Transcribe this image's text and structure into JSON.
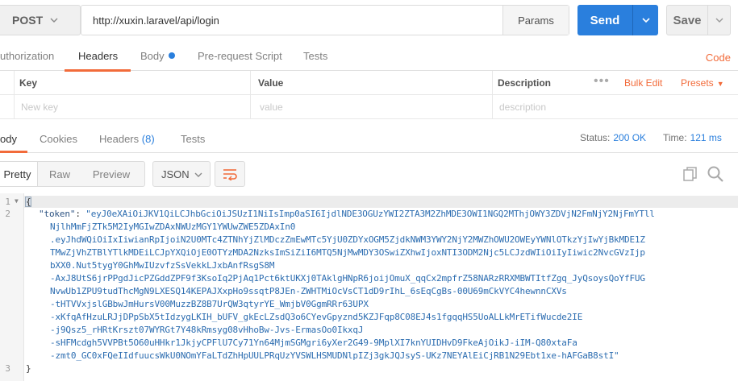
{
  "request": {
    "method": "POST",
    "url": "http://xuxin.laravel/api/login",
    "params_label": "Params",
    "send_label": "Send",
    "save_label": "Save"
  },
  "request_tabs": [
    {
      "label": "uthorization"
    },
    {
      "label": "Headers"
    },
    {
      "label": "Body"
    },
    {
      "label": "Pre-request Script"
    },
    {
      "label": "Tests"
    }
  ],
  "code_label": "Code",
  "headers_table": {
    "columns": [
      "Key",
      "Value",
      "Description"
    ],
    "bulk_edit": "Bulk Edit",
    "presets": "Presets",
    "placeholders": [
      "New key",
      "value",
      "description"
    ]
  },
  "response_tabs": [
    {
      "label": "ody"
    },
    {
      "label": "Cookies"
    },
    {
      "label": "Headers",
      "count": "(8)"
    },
    {
      "label": "Tests"
    }
  ],
  "response_status": {
    "status_label": "Status:",
    "status_value": "200 OK",
    "time_label": "Time:",
    "time_value": "121 ms"
  },
  "response_toolbar": {
    "formats": [
      "Pretty",
      "Raw",
      "Preview"
    ],
    "active_format": "Pretty",
    "language": "JSON"
  },
  "response_body": {
    "line_numbers": [
      "1",
      "2",
      "3"
    ],
    "open_brace": "{",
    "close_brace": "}",
    "token_key": "\"token\"",
    "token_lines": [
      "\"eyJ0eXAiOiJKV1QiLCJhbGciOiJSUzI1NiIsImp0aSI6IjdlNDE3OGUzYWI2ZTA3M2ZhMDE3OWI1NGQ2MThjOWY3ZDVjN2FmNjY2NjFmYTll",
      "NjlhMmFjZTk5M2IyMGIwZDAxNWUzMGY1YWUwZWE5ZDAxIn0",
      ".eyJhdWQiOiIxIiwianRpIjoiN2U0MTc4ZTNhYjZlMDczZmEwMTc5YjU0ZDYxOGM5ZjdkNWM3YWY2NjY2MWZhOWU2OWEyYWNlOTkzYjIwYjBkMDE1Z",
      "TMwZjVhZTBlYTlkMDEiLCJpYXQiOjE0OTYzMDA2NzksImSiZiI6MTQ5NjMwMDY3OSwiZXhwIjoxNTI3ODM2Njc5LCJzdWIiOiIyIiwic2NvcGVzIjp",
      "bXX0.Nut5tygY0GhMwIUzvfzSsVekkLJxbAnfRsgS8M",
      "-AxJ8UtS6jrPPgdJicPZGddZPF9f3KsoIq2PjAq1Pct6ktUKXj0TAklgHNpR6joijOmuX_qqCx2mpfrZ58NARzRRXMBWTItfZgq_JyQsoysQoYfFUG",
      "NvwUb1ZPU9tudThcMgN9LXESQ14KEPAJXxpHo9ssqtP8JEn-ZWHTMiOcVsCT1dD9rIhL_6sEqCgBs-00U69mCkVYC4hewnnCXVs",
      "-tHTVVxjslGBbwJmHursV00MuzzBZ8B7UrQW3qtyrYE_WmjbV0GgmRRr63UPX",
      "-xKfqAfHzuLRJjDPpSbX5tIdzygLKIH_bUFV_gkEcLZsdQ3o6CYevGpyznd5KZJFqp8C08EJ4s1fgqqHS5UoALLkMrETifWucde2IE",
      "-j9Qsz5_rHRtKrszt07WYRGt7Y48kRmsyg08vHhoBw-Jvs-ErmasOo0IkxqJ",
      "-sHFMcdgh5VVPBt5O60uHHkr1JkjyCPFlU7Cy71Yn64MjmSGMgri6yXer2G49-9MplXI7knYUIDHvD9FkeAjOikJ-iIM-Q80xtaFa",
      "-zmt0_GC0xFQeIIdfuucsWkU0NOmYFaLTdZhHpUULPRqUzYVSWLHSMUDNlpIZj3gkJQJsyS-UKz7NEYAlEiCjRB1N29Ebt1xe-hAFGaB8stI\""
    ]
  },
  "colors": {
    "accent_orange": "#f26b3a",
    "send_blue": "#2a7fdd"
  }
}
